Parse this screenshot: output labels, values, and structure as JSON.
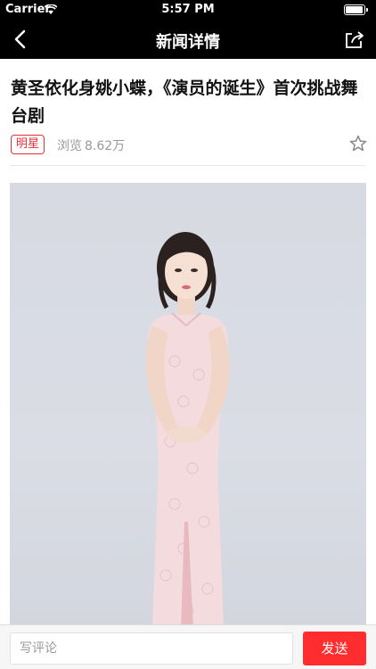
{
  "status_bar": {
    "carrier": "Carrier",
    "time": "5:57 PM",
    "battery_level": 0.95
  },
  "nav": {
    "title": "新闻详情",
    "back_icon": "chevron-left-icon",
    "share_icon": "share-icon"
  },
  "article": {
    "title": "黄圣依化身姚小蝶，《演员的诞生》首次挑战舞台剧",
    "category": "明星",
    "views_label": "浏览",
    "views_value": "8.62万",
    "favorite_icon": "star-outline-icon",
    "accent_color": "#e8303a"
  },
  "comment_bar": {
    "placeholder": "写评论",
    "send_label": "发送",
    "send_color": "#ff2d2d"
  }
}
